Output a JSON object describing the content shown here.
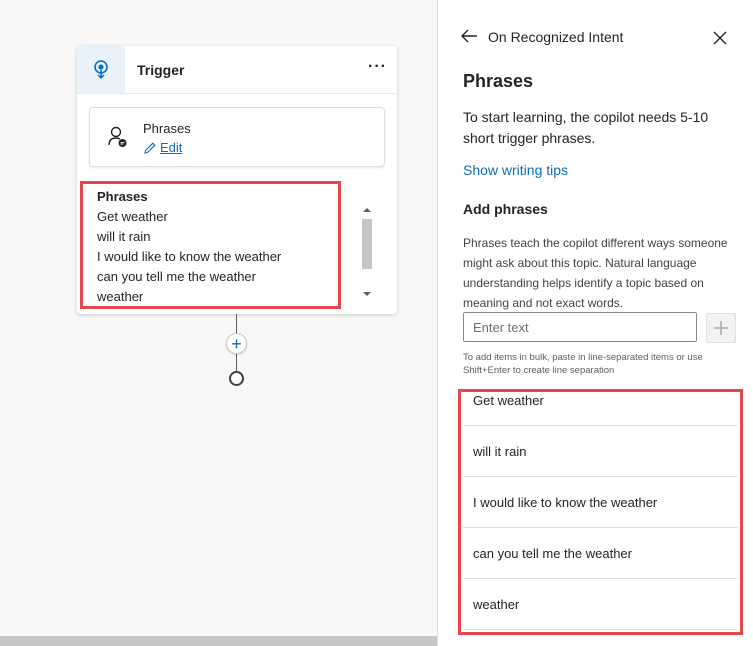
{
  "node": {
    "title": "Trigger",
    "more_label": "···",
    "card": {
      "title": "Phrases",
      "edit_label": "Edit"
    },
    "phrases_label": "Phrases",
    "phrases": [
      "Get weather",
      "will it rain",
      "I would like to know the weather",
      "can you tell me the weather",
      "weather"
    ]
  },
  "flow": {
    "add_label": "+"
  },
  "panel": {
    "header_title": "On Recognized Intent",
    "title": "Phrases",
    "description": "To start learning, the copilot needs 5-10 short trigger phrases.",
    "tips_link": "Show writing tips",
    "add_heading": "Add phrases",
    "add_help": "Phrases teach the copilot different ways someone might ask about this topic. Natural language understanding helps identify a topic based on meaning and not exact words.",
    "input_placeholder": "Enter text",
    "bulk_hint": "To add items in bulk, paste in line-separated items or use Shift+Enter to create line separation",
    "phrases": [
      "Get weather",
      "will it rain",
      "I would like to know the weather",
      "can you tell me the weather",
      "weather"
    ]
  },
  "colors": {
    "accent": "#0f6cbd",
    "highlight": "#e5484d",
    "trigger_bg": "#e8f2fb"
  }
}
